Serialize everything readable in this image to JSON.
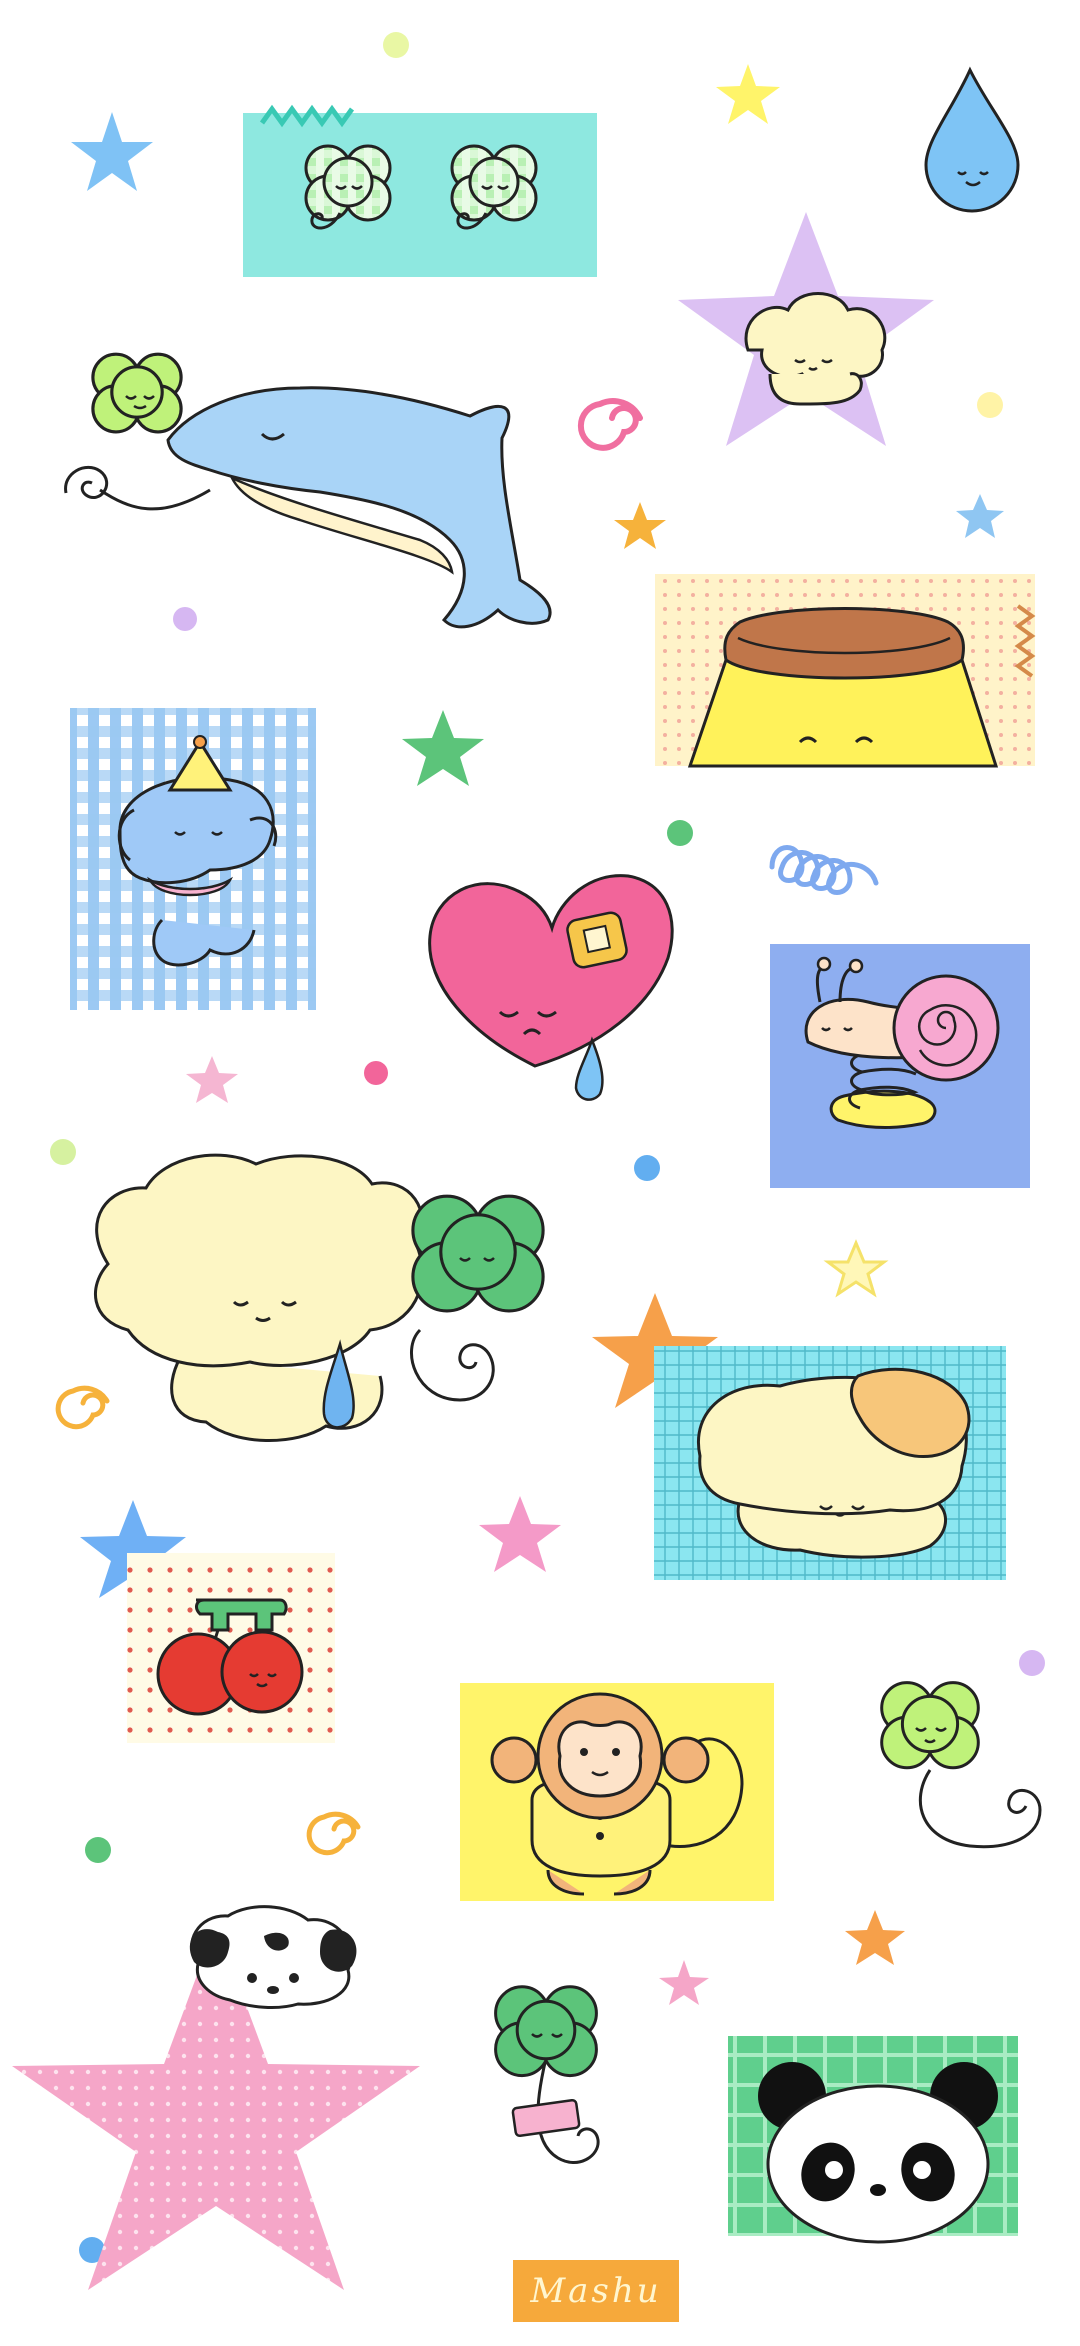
{
  "wallpaper": {
    "signature": "Mashu",
    "stickers": [
      {
        "name": "clover-pair-card",
        "label": ""
      },
      {
        "name": "dolphin-with-clover",
        "label": ""
      },
      {
        "name": "star-mushroom",
        "label": ""
      },
      {
        "name": "pudding-card",
        "label": ""
      },
      {
        "name": "party-elephant-card",
        "label": ""
      },
      {
        "name": "crying-heart",
        "label": ""
      },
      {
        "name": "snail-spring-card",
        "label": ""
      },
      {
        "name": "fluffy-pup-with-clover",
        "label": ""
      },
      {
        "name": "sleeping-pup-plaid-card",
        "label": ""
      },
      {
        "name": "cherries-card",
        "label": ""
      },
      {
        "name": "monkey-card",
        "label": ""
      },
      {
        "name": "clover-balloon",
        "label": ""
      },
      {
        "name": "cow-pup-pink-star",
        "label": ""
      },
      {
        "name": "clover-bandage",
        "label": ""
      },
      {
        "name": "panda-card",
        "label": ""
      }
    ],
    "colors": {
      "background": "#ffffff",
      "mint": "#8ee8e0",
      "lavender": "#dcc1f3",
      "sky_blue": "#9fd0f0",
      "pink": "#f2659a",
      "cream": "#fdf6c4",
      "yellow": "#fff46a",
      "orange": "#f6a93b",
      "green": "#5cc47a",
      "periwinkle": "#8eaef0"
    }
  }
}
